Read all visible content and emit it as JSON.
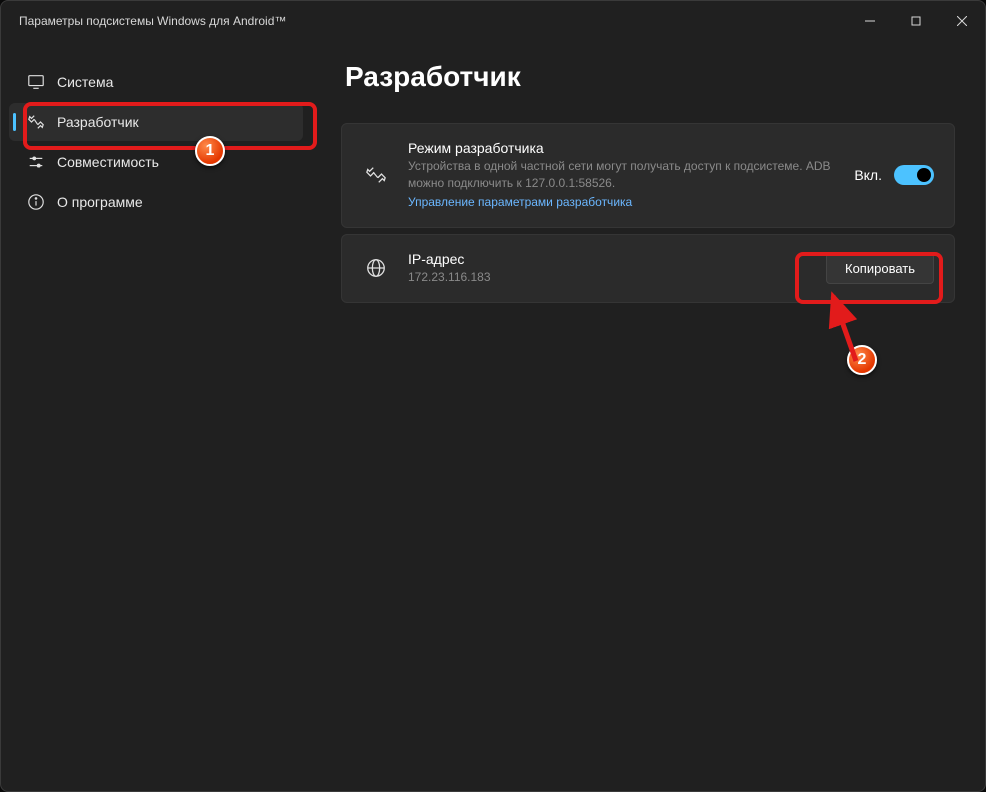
{
  "window": {
    "title": "Параметры подсистемы Windows для Android™"
  },
  "sidebar": {
    "items": [
      {
        "label": "Система"
      },
      {
        "label": "Разработчик"
      },
      {
        "label": "Совместимость"
      },
      {
        "label": "О программе"
      }
    ]
  },
  "main": {
    "title": "Разработчик",
    "devmode": {
      "title": "Режим разработчика",
      "desc": "Устройства в одной частной сети могут получать доступ к подсистеме. ADB можно подключить к 127.0.0.1:58526.",
      "link": "Управление параметрами разработчика",
      "toggle_label": "Вкл."
    },
    "ip": {
      "title": "IP-адрес",
      "value": "172.23.116.183",
      "copy_label": "Копировать"
    }
  },
  "annotations": {
    "badge1": "1",
    "badge2": "2"
  }
}
